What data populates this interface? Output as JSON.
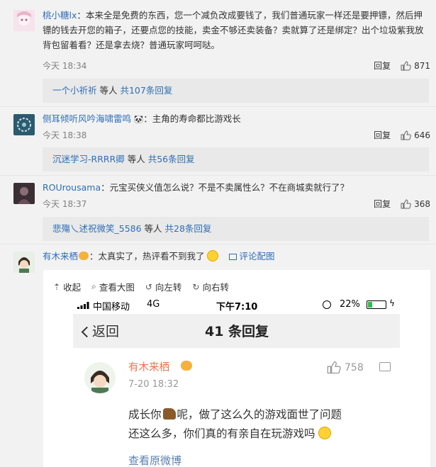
{
  "comments": [
    {
      "user": "桃小糖lx",
      "text": "：本来全是免费的东西，您一个减负改成要钱了，我们普通玩家一样还是要押镖，然后押镖的钱去开您的箱子，还要点您的技能，卖金不够还卖装备？卖就算了还是绑定？出个垃圾紫我放背包留着看？还是拿去烧？普通玩家呵呵哒。",
      "time": "今天 18:34",
      "reply": "回复",
      "likes": "871",
      "sub_users": "一个小祈祈",
      "sub_plain": " 等人 ",
      "sub_count": "共107条回复"
    },
    {
      "user": "侧耳倾听风吟海啸雷鸣",
      "text": "：主角的寿命都比游戏长",
      "time": "今天 18:38",
      "reply": "回复",
      "likes": "646",
      "sub_users": "沉迷学习-RRRR卿",
      "sub_plain": " 等人 ",
      "sub_count": "共56条回复"
    },
    {
      "user": "ROUrousama",
      "text": "：元宝买侠义值怎么说？不是不卖属性么？不在商城卖就行了？",
      "time": "今天 18:37",
      "reply": "回复",
      "likes": "368",
      "sub_users": "悲殤乀述祝微笑_5586",
      "sub_plain": " 等人 ",
      "sub_count": "共28条回复"
    },
    {
      "user": "有木来栖",
      "text": "：太真实了，热评看不到我了",
      "pic_label": "评论配图"
    }
  ],
  "toolbar": {
    "collapse": "收起",
    "view_large": "查看大图",
    "rotate_left": "向左转",
    "rotate_right": "向右转"
  },
  "phone": {
    "carrier": "中国移动",
    "network": "4G",
    "time": "下午7:10",
    "battery": "22%",
    "back": "返回",
    "title": "41 条回复",
    "card_user": "有木来栖",
    "card_time": "7-20 18:32",
    "card_likes": "758",
    "card_text_1": "成长你",
    "card_text_2": "呢，做了这么久的游戏面世了问题",
    "card_text_3": "还这么多，你们真的有亲自在玩游戏吗",
    "card_link": "查看原微博"
  },
  "colors": {
    "accent": "#eb7350",
    "link": "#2e6eb5"
  }
}
